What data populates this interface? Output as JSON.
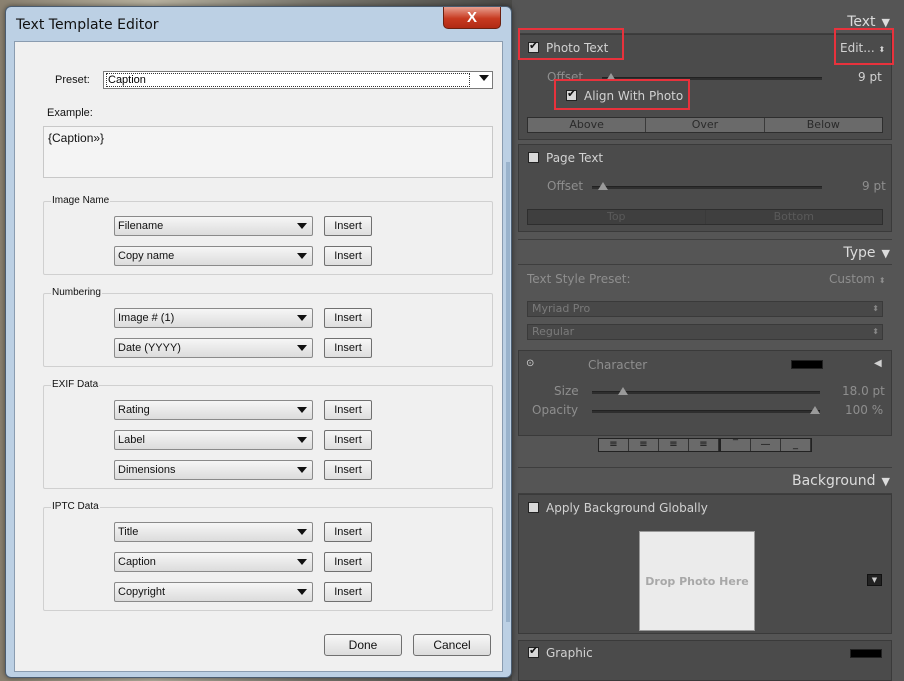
{
  "panel": {
    "text_header": "Text",
    "photo_text_label": "Photo Text",
    "photo_text_checked": true,
    "edit_label": "Edit...",
    "offset_label": "Offset",
    "offset_value": "9 pt",
    "align_with_photo_label": "Align With Photo",
    "align_with_photo_checked": true,
    "align_options": [
      "Above",
      "Over",
      "Below"
    ],
    "page_text_label": "Page Text",
    "page_text_checked": false,
    "page_offset_label": "Offset",
    "page_offset_value": "9 pt",
    "page_options": [
      "Top",
      "Bottom"
    ],
    "type_header": "Type",
    "text_style_preset_label": "Text Style Preset:",
    "text_style_preset_value": "Custom",
    "font_family": "Myriad Pro",
    "font_style": "Regular",
    "character_label": "Character",
    "size_label": "Size",
    "size_value": "18.0 pt",
    "opacity_label": "Opacity",
    "opacity_value": "100 %",
    "background_header": "Background",
    "apply_bg_label": "Apply Background Globally",
    "apply_bg_checked": false,
    "drop_photo_label": "Drop Photo Here",
    "graphic_label": "Graphic",
    "graphic_checked": true,
    "colors": {
      "highlight": "#e8323c",
      "panel": "#555555"
    }
  },
  "dialog": {
    "title": "Text Template Editor",
    "close_glyph": "X",
    "preset_label": "Preset:",
    "preset_value": "Caption",
    "example_label": "Example:",
    "example_text": "{Caption»}",
    "insert_label": "Insert",
    "groups": [
      {
        "title": "Image Name",
        "dropdowns": [
          "Filename",
          "Copy name"
        ]
      },
      {
        "title": "Numbering",
        "dropdowns": [
          "Image # (1)",
          "Date (YYYY)"
        ]
      },
      {
        "title": "EXIF Data",
        "dropdowns": [
          "Rating",
          "Label",
          "Dimensions"
        ]
      },
      {
        "title": "IPTC Data",
        "dropdowns": [
          "Title",
          "Caption",
          "Copyright"
        ]
      }
    ],
    "done_label": "Done",
    "cancel_label": "Cancel"
  }
}
